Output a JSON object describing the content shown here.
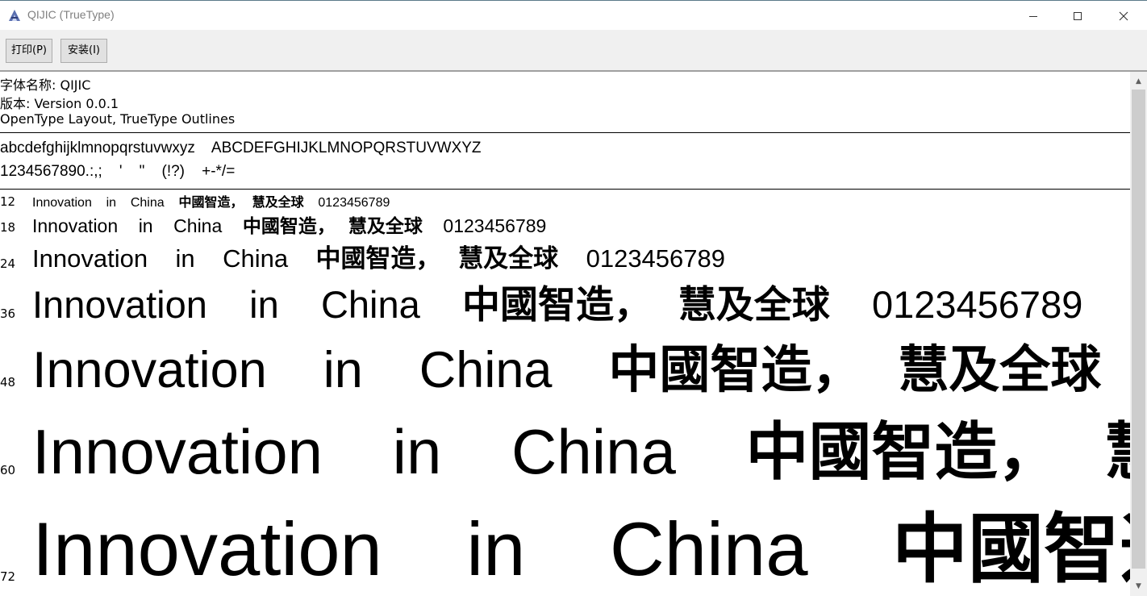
{
  "window": {
    "title": "QIJIC (TrueType)",
    "icon": "font-viewer-icon"
  },
  "toolbar": {
    "print_label": "打印(P)",
    "install_label": "安装(I)"
  },
  "font_info": {
    "name": "字体名称: QIJIC",
    "version": "版本: Version 0.0.1",
    "format": "OpenType Layout, TrueType Outlines"
  },
  "charset": {
    "letters": "abcdefghijklmnopqrstuvwxyz    ABCDEFGHIJKLMNOPQRSTUVWXYZ",
    "symbols": "1234567890.:,;    '    \"    (!?)    +-*/="
  },
  "samples": {
    "latin": "Innovation    in    China",
    "cjk": "中國智造，  慧及全球",
    "digits": "0123456789",
    "rows": [
      {
        "size": "12"
      },
      {
        "size": "18"
      },
      {
        "size": "24"
      },
      {
        "size": "36"
      },
      {
        "size": "48"
      },
      {
        "size": "60"
      },
      {
        "size": "72"
      }
    ]
  }
}
